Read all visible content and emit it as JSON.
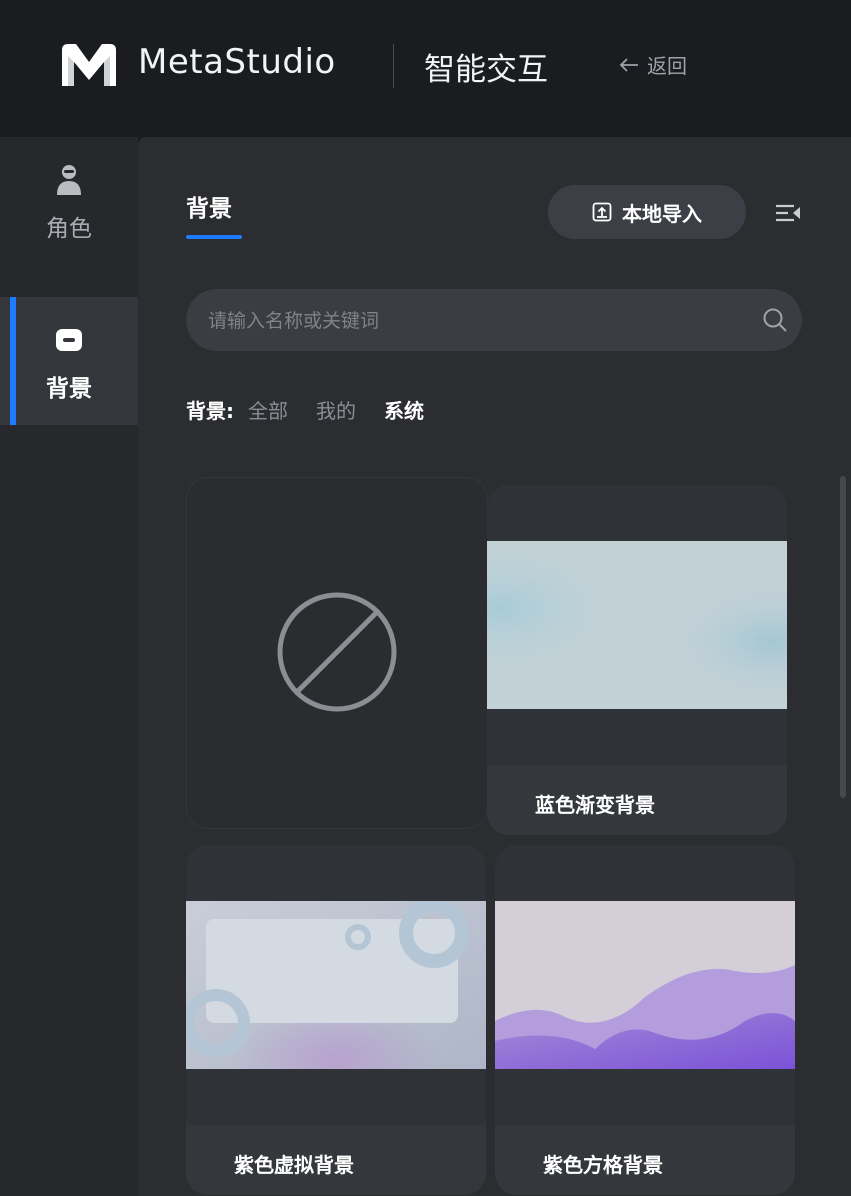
{
  "header": {
    "brand": "MetaStudio",
    "product": "智能交互",
    "back_label": "返回"
  },
  "nav": {
    "items": [
      {
        "label": "角色",
        "icon": "person-icon",
        "active": false
      },
      {
        "label": "背景",
        "icon": "background-icon",
        "active": true
      }
    ]
  },
  "panel": {
    "tab_title": "背景",
    "import_label": "本地导入",
    "search": {
      "placeholder": "请输入名称或关键词",
      "value": ""
    },
    "filter": {
      "label": "背景:",
      "options": [
        "全部",
        "我的",
        "系统"
      ],
      "selected": "系统"
    },
    "cards": [
      {
        "label": "",
        "kind": "none",
        "icon": "no-background-icon"
      },
      {
        "label": "蓝色渐变背景",
        "kind": "blue-gradient"
      },
      {
        "label": "紫色虚拟背景",
        "kind": "purple-virtual"
      },
      {
        "label": "紫色方格背景",
        "kind": "purple-grid"
      }
    ]
  },
  "colors": {
    "accent": "#1e7bff",
    "background": "#1b1c1f",
    "panel": "#2b2d31"
  }
}
